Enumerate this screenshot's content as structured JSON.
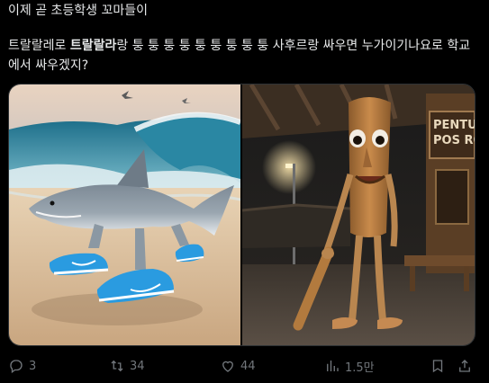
{
  "post": {
    "header_text": "이제 곧 초등학생 꼬마들이",
    "body_part1": "트랄랄레로 ",
    "body_bold": "트랄랄라",
    "body_part2": "랑 퉁 퉁 퉁 퉁 퉁 퉁 퉁 퉁 퉁 사후르랑 싸우면 누가이기나요로 학교에서 싸우겠지?",
    "left_image_desc": "shark-with-blue-sneakers",
    "right_image_desc": "wooden-figure-with-bat",
    "sign_text_line1": "PENTUN",
    "sign_text_line2": "POS RO"
  },
  "actions": {
    "reply_count": "3",
    "repost_count": "34",
    "like_count": "44",
    "view_count": "1.5만"
  },
  "colors": {
    "background": "#000000",
    "text": "#e7e9ea",
    "muted": "#71767b",
    "sneaker_blue": "#2a9be0"
  }
}
